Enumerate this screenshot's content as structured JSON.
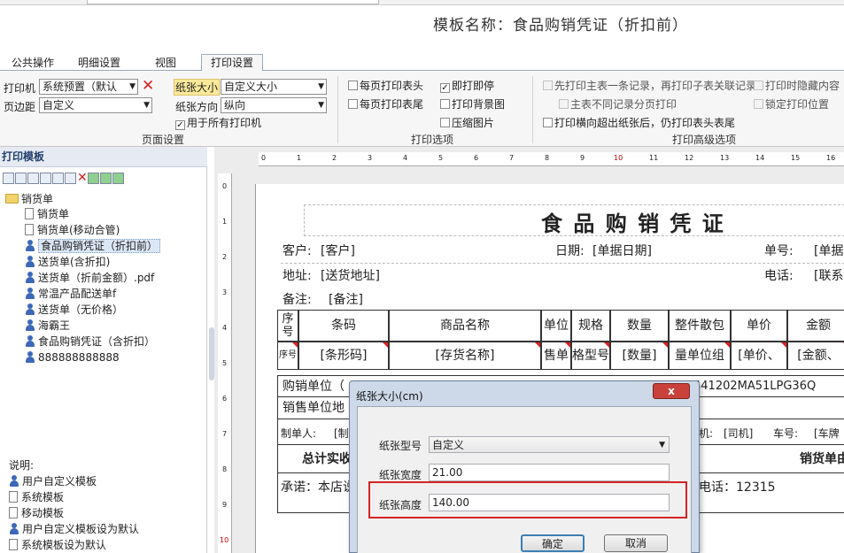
{
  "template_title": "模板名称：食品购销凭证（折扣前）",
  "tabs": [
    "公共操作",
    "明细设置",
    "视图",
    "打印设置"
  ],
  "page_settings": {
    "printer_label": "打印机",
    "printer_value": "系统预置（默认",
    "margin_label": "页边距",
    "margin_value": "自定义",
    "paper_size_label": "纸张大小",
    "paper_size_value": "自定义大小",
    "orientation_label": "纸张方向",
    "orientation_value": "纵向",
    "all_printers": "用于所有打印机",
    "caption": "页面设置"
  },
  "print_options": {
    "header_each_page": "每页打印表头",
    "footer_each_page": "每页打印表尾",
    "print_stop": "即打即停",
    "print_background": "打印背景图",
    "compress_image": "压缩图片",
    "caption": "打印选项"
  },
  "advanced": {
    "master_first": "先打印主表一条记录，再打印子表关联记录",
    "hide_content": "打印时隐藏内容",
    "page_per_master": "主表不同记录分页打印",
    "lock_position": "锁定打印位置",
    "overflow_header": "打印横向超出纸张后，仍打印表头表尾",
    "caption": "打印高级选项"
  },
  "left_panel": {
    "title": "打印模板",
    "tree": {
      "root": "销货单",
      "items": [
        "销货单",
        "销货单(移动合管)",
        "食品购销凭证（折扣前）",
        "送货单(含折扣)",
        "送货单（折前金额）.pdf",
        "常温产品配送单f",
        "送货单（无价格）",
        "海霸王",
        "食品购销凭证（含折扣）",
        "888888888888"
      ]
    },
    "notes_title": "说明:",
    "notes": [
      "用户自定义模板",
      "系统模板",
      "移动模板",
      "用户自定义模板设为默认",
      "系统模板设为默认"
    ]
  },
  "rulers": {
    "h": [
      "0",
      "1",
      "2",
      "3",
      "4",
      "5",
      "6",
      "7",
      "8",
      "9",
      "10",
      "11",
      "12",
      "13",
      "14",
      "15",
      "16"
    ],
    "v": [
      "0",
      "1",
      "2",
      "3",
      "4",
      "5",
      "6",
      "7",
      "8",
      "9",
      "10"
    ]
  },
  "document": {
    "heading": "食 品 购 销 凭 证",
    "customer_label": "客户:",
    "customer_value": "[客户]",
    "date_label": "日期:",
    "date_value": "[单据日期]",
    "no_label": "单号:",
    "no_value": "[单据",
    "address_label": "地址:",
    "address_value": "[送货地址]",
    "phone_label": "电话:",
    "phone_value": "[联系",
    "remark_label": "备注:",
    "remark_value": "[备注]",
    "columns": [
      "序号",
      "条码",
      "商品名称",
      "单位",
      "规格",
      "数量",
      "整件散包",
      "单价",
      "金额"
    ],
    "row": [
      "序号",
      "[条形码]",
      "[存货名称]",
      "售单",
      "格型号",
      "[数量]",
      "量单位组",
      "[单价、",
      "[金额、"
    ],
    "buyer_label": "购销单位（",
    "credit_code": "441202MA51LPG36Q",
    "seller_label": "销售单位地",
    "maker_label": "制单人:",
    "maker_value": "[制",
    "driver_label": "机:",
    "driver_value": "[司机]",
    "plate_label": "车号:",
    "plate_value": "[车牌",
    "total_label": "总计实收",
    "sales_unit": "销货单由",
    "promise": "承诺：本店说",
    "complaint": "电话：12315"
  },
  "dialog": {
    "title": "纸张大小(cm)",
    "close": "x",
    "type_label": "纸张型号",
    "type_value": "自定义",
    "width_label": "纸张宽度",
    "width_value": "21.00",
    "height_label": "纸张高度",
    "height_value": "140.00",
    "ok": "确定",
    "cancel": "取消"
  }
}
